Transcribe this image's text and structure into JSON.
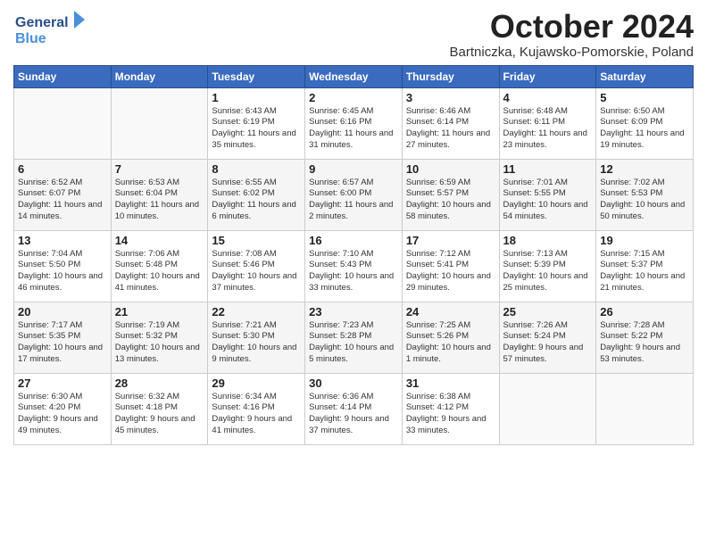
{
  "logo": {
    "line1": "General",
    "line2": "Blue"
  },
  "title": "October 2024",
  "subtitle": "Bartniczka, Kujawsko-Pomorskie, Poland",
  "weekdays": [
    "Sunday",
    "Monday",
    "Tuesday",
    "Wednesday",
    "Thursday",
    "Friday",
    "Saturday"
  ],
  "weeks": [
    [
      {
        "day": "",
        "info": ""
      },
      {
        "day": "",
        "info": ""
      },
      {
        "day": "1",
        "info": "Sunrise: 6:43 AM\nSunset: 6:19 PM\nDaylight: 11 hours and 35 minutes."
      },
      {
        "day": "2",
        "info": "Sunrise: 6:45 AM\nSunset: 6:16 PM\nDaylight: 11 hours and 31 minutes."
      },
      {
        "day": "3",
        "info": "Sunrise: 6:46 AM\nSunset: 6:14 PM\nDaylight: 11 hours and 27 minutes."
      },
      {
        "day": "4",
        "info": "Sunrise: 6:48 AM\nSunset: 6:11 PM\nDaylight: 11 hours and 23 minutes."
      },
      {
        "day": "5",
        "info": "Sunrise: 6:50 AM\nSunset: 6:09 PM\nDaylight: 11 hours and 19 minutes."
      }
    ],
    [
      {
        "day": "6",
        "info": "Sunrise: 6:52 AM\nSunset: 6:07 PM\nDaylight: 11 hours and 14 minutes."
      },
      {
        "day": "7",
        "info": "Sunrise: 6:53 AM\nSunset: 6:04 PM\nDaylight: 11 hours and 10 minutes."
      },
      {
        "day": "8",
        "info": "Sunrise: 6:55 AM\nSunset: 6:02 PM\nDaylight: 11 hours and 6 minutes."
      },
      {
        "day": "9",
        "info": "Sunrise: 6:57 AM\nSunset: 6:00 PM\nDaylight: 11 hours and 2 minutes."
      },
      {
        "day": "10",
        "info": "Sunrise: 6:59 AM\nSunset: 5:57 PM\nDaylight: 10 hours and 58 minutes."
      },
      {
        "day": "11",
        "info": "Sunrise: 7:01 AM\nSunset: 5:55 PM\nDaylight: 10 hours and 54 minutes."
      },
      {
        "day": "12",
        "info": "Sunrise: 7:02 AM\nSunset: 5:53 PM\nDaylight: 10 hours and 50 minutes."
      }
    ],
    [
      {
        "day": "13",
        "info": "Sunrise: 7:04 AM\nSunset: 5:50 PM\nDaylight: 10 hours and 46 minutes."
      },
      {
        "day": "14",
        "info": "Sunrise: 7:06 AM\nSunset: 5:48 PM\nDaylight: 10 hours and 41 minutes."
      },
      {
        "day": "15",
        "info": "Sunrise: 7:08 AM\nSunset: 5:46 PM\nDaylight: 10 hours and 37 minutes."
      },
      {
        "day": "16",
        "info": "Sunrise: 7:10 AM\nSunset: 5:43 PM\nDaylight: 10 hours and 33 minutes."
      },
      {
        "day": "17",
        "info": "Sunrise: 7:12 AM\nSunset: 5:41 PM\nDaylight: 10 hours and 29 minutes."
      },
      {
        "day": "18",
        "info": "Sunrise: 7:13 AM\nSunset: 5:39 PM\nDaylight: 10 hours and 25 minutes."
      },
      {
        "day": "19",
        "info": "Sunrise: 7:15 AM\nSunset: 5:37 PM\nDaylight: 10 hours and 21 minutes."
      }
    ],
    [
      {
        "day": "20",
        "info": "Sunrise: 7:17 AM\nSunset: 5:35 PM\nDaylight: 10 hours and 17 minutes."
      },
      {
        "day": "21",
        "info": "Sunrise: 7:19 AM\nSunset: 5:32 PM\nDaylight: 10 hours and 13 minutes."
      },
      {
        "day": "22",
        "info": "Sunrise: 7:21 AM\nSunset: 5:30 PM\nDaylight: 10 hours and 9 minutes."
      },
      {
        "day": "23",
        "info": "Sunrise: 7:23 AM\nSunset: 5:28 PM\nDaylight: 10 hours and 5 minutes."
      },
      {
        "day": "24",
        "info": "Sunrise: 7:25 AM\nSunset: 5:26 PM\nDaylight: 10 hours and 1 minute."
      },
      {
        "day": "25",
        "info": "Sunrise: 7:26 AM\nSunset: 5:24 PM\nDaylight: 9 hours and 57 minutes."
      },
      {
        "day": "26",
        "info": "Sunrise: 7:28 AM\nSunset: 5:22 PM\nDaylight: 9 hours and 53 minutes."
      }
    ],
    [
      {
        "day": "27",
        "info": "Sunrise: 6:30 AM\nSunset: 4:20 PM\nDaylight: 9 hours and 49 minutes."
      },
      {
        "day": "28",
        "info": "Sunrise: 6:32 AM\nSunset: 4:18 PM\nDaylight: 9 hours and 45 minutes."
      },
      {
        "day": "29",
        "info": "Sunrise: 6:34 AM\nSunset: 4:16 PM\nDaylight: 9 hours and 41 minutes."
      },
      {
        "day": "30",
        "info": "Sunrise: 6:36 AM\nSunset: 4:14 PM\nDaylight: 9 hours and 37 minutes."
      },
      {
        "day": "31",
        "info": "Sunrise: 6:38 AM\nSunset: 4:12 PM\nDaylight: 9 hours and 33 minutes."
      },
      {
        "day": "",
        "info": ""
      },
      {
        "day": "",
        "info": ""
      }
    ]
  ]
}
